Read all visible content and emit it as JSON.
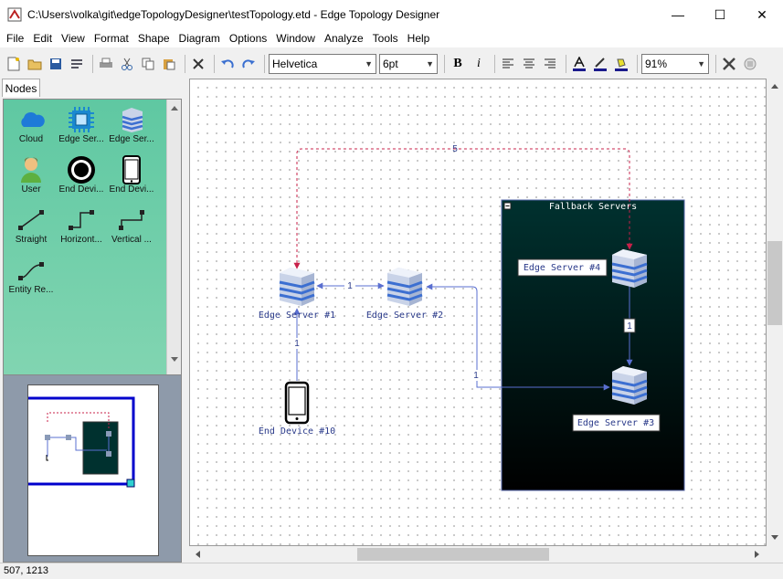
{
  "window": {
    "title": "C:\\Users\\volka\\git\\edgeTopologyDesigner\\testTopology.etd - Edge Topology Designer",
    "minimize": "—",
    "maximize": "☐",
    "close": "✕"
  },
  "menu": [
    "File",
    "Edit",
    "View",
    "Format",
    "Shape",
    "Diagram",
    "Options",
    "Window",
    "Analyze",
    "Tools",
    "Help"
  ],
  "toolbar": {
    "font": "Helvetica",
    "size": "6pt",
    "zoom": "91%",
    "bold": "B",
    "italic": "i"
  },
  "palette": {
    "tab": "Nodes",
    "items": [
      "Cloud",
      "Edge Ser...",
      "Edge Ser...",
      "User",
      "End Devi...",
      "End Devi...",
      "Straight",
      "Horizont...",
      "Vertical ...",
      "Entity Re..."
    ]
  },
  "diagram": {
    "container_title": "Fallback Servers",
    "nodes": [
      "Edge Server #1",
      "Edge Server #2",
      "Edge Server #4",
      "Edge Server #3",
      "End Device #10"
    ],
    "edges": [
      "5",
      "1",
      "1",
      "1",
      "1"
    ]
  },
  "status": "507, 1213",
  "colors": {
    "palette_top": "#5fc8a2",
    "container_bg": "#00312f",
    "edge": "#5a6fd0",
    "dashed_edge": "#c8204a",
    "overview_frame": "#0000cc"
  }
}
